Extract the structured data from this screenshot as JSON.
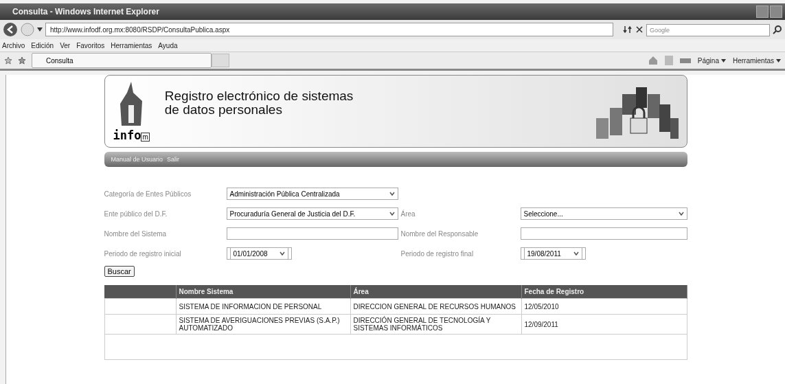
{
  "window": {
    "title": "Consulta - Windows Internet Explorer"
  },
  "address_bar": {
    "url": "http://www.infodf.org.mx:8080/RSDP/ConsultaPublica.aspx",
    "search_placeholder": "Google"
  },
  "menu": [
    "Archivo",
    "Edición",
    "Ver",
    "Favoritos",
    "Herramientas",
    "Ayuda"
  ],
  "tab": {
    "label": "Consulta"
  },
  "command_bar": [
    "Página",
    "Herramientas"
  ],
  "banner": {
    "logo_text": "info",
    "logo_suffix": "m",
    "title_lines": [
      "Registro electrónico de sistemas",
      "de datos personales"
    ]
  },
  "nav": [
    "Manual de Usuario",
    "Salir"
  ],
  "form": {
    "rows": [
      {
        "left": {
          "label": "Categoría de Entes Públicos",
          "kind": "select",
          "value": "Administración Pública Centralizada"
        }
      },
      {
        "left": {
          "label": "Ente público del D.F.",
          "kind": "select",
          "value": "Procuraduría General de Justicia del D.F."
        },
        "right": {
          "label": "Área",
          "kind": "select",
          "value": "Seleccione..."
        }
      },
      {
        "left": {
          "label": "Nombre del Sistema",
          "kind": "text"
        },
        "right": {
          "label": "Nombre del Responsable",
          "kind": "text"
        }
      },
      {
        "left": {
          "label": "Periodo de registro inicial",
          "kind": "date",
          "value": "01/01/2008"
        },
        "right": {
          "label": "Periodo de registro final",
          "kind": "date",
          "value": "19/08/2011"
        }
      }
    ],
    "button": "Buscar"
  },
  "table": {
    "columns": [
      null,
      "Nombre Sistema",
      "Área",
      "Fecha de Registro"
    ],
    "rows": [
      [
        null,
        "SISTEMA DE INFORMACION DE PERSONAL",
        "DIRECCION GENERAL DE RECURSOS HUMANOS",
        "12/05/2010"
      ],
      [
        null,
        "SISTEMA DE AVERIGUACIONES PREVIAS (S.A.P.) AUTOMATIZADO",
        "DIRECCIÓN GENERAL DE TECNOLOGÍA Y SISTEMAS INFORMÁTICOS",
        "12/09/2011"
      ]
    ]
  }
}
